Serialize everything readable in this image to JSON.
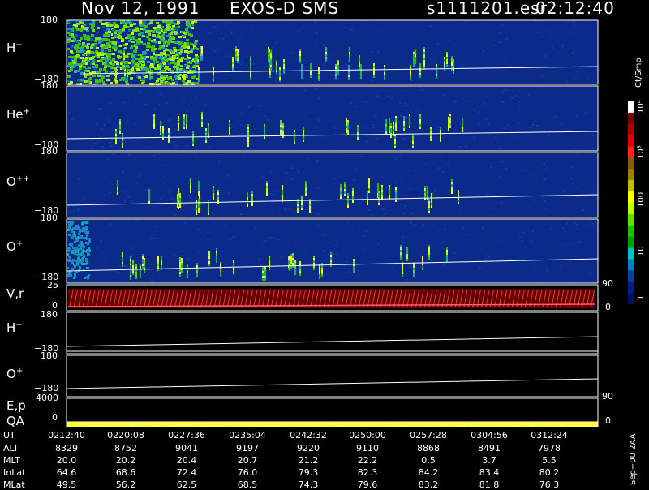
{
  "header": {
    "date": "Nov 12, 1991",
    "instrument": "EXOS-D  SMS",
    "file": "s1111201.esr",
    "time": "02:12:40"
  },
  "panels": [
    {
      "id": "hplus",
      "species": "H",
      "charge": "+",
      "ytop": "180",
      "ybot": "−180"
    },
    {
      "id": "heplus",
      "species": "He",
      "charge": "+",
      "ytop": "180",
      "ybot": "−180"
    },
    {
      "id": "oplusplus",
      "species": "O",
      "charge": "++",
      "ytop": "180",
      "ybot": "−180"
    },
    {
      "id": "oplus",
      "species": "O",
      "charge": "+",
      "ytop": "180",
      "ybot": "−180"
    }
  ],
  "vr_panel": {
    "label": "V,r",
    "ytop": "25",
    "ybot": "0",
    "rtop": "90",
    "rbot": "0"
  },
  "lower_panels": [
    {
      "id": "hplus2",
      "species": "H",
      "charge": "+",
      "ytop": "180",
      "ybot": "−180"
    },
    {
      "id": "oplus2",
      "species": "O",
      "charge": "+",
      "ytop": "180",
      "ybot": "−180"
    }
  ],
  "ep_panel": {
    "label1": "E,p",
    "label2": "QA",
    "ytop": "4000",
    "ybot": "0",
    "rtop": "90",
    "rbot": "0"
  },
  "colorbar": {
    "unit": "Ct/Smp",
    "ticks": [
      "10⁴",
      "10³",
      "100",
      "10",
      "1"
    ],
    "colors": [
      "#ffffff",
      "#7a0000",
      "#b00000",
      "#e00000",
      "#ff2020",
      "#806000",
      "#a08000",
      "#c0c000",
      "#ffff00",
      "#c0ff00",
      "#60e000",
      "#20c000",
      "#00a000",
      "#00c0c0",
      "#0080c0",
      "#0040a0",
      "#002080",
      "#001060"
    ]
  },
  "footer_side": "Sep−00  2AA",
  "table": {
    "rows": [
      {
        "label": "UT",
        "values": [
          "0212:40",
          "0220:08",
          "0227:36",
          "0235:04",
          "0242:32",
          "0250:00",
          "0257:28",
          "0304:56",
          "0312:24"
        ]
      },
      {
        "label": "ALT",
        "values": [
          "8329",
          "8752",
          "9041",
          "9197",
          "9220",
          "9110",
          "8868",
          "8491",
          "7978"
        ]
      },
      {
        "label": "MLT",
        "values": [
          "20.0",
          "20.2",
          "20.4",
          "20.7",
          "21.2",
          "22.2",
          "0.5",
          "3.7",
          "5.5"
        ]
      },
      {
        "label": "InLat",
        "values": [
          "64.6",
          "68.6",
          "72.4",
          "76.0",
          "79.3",
          "82.3",
          "84.2",
          "83.4",
          "80.2"
        ]
      },
      {
        "label": "MLat",
        "values": [
          "49.5",
          "56.2",
          "62.5",
          "68.5",
          "74.3",
          "79.6",
          "83.2",
          "81.8",
          "76.3"
        ]
      }
    ]
  },
  "chart_data": {
    "type": "heatmap",
    "x_ticks": [
      "0212:40",
      "0220:08",
      "0227:36",
      "0235:04",
      "0242:32",
      "0250:00",
      "0257:28",
      "0304:56",
      "0312:24"
    ],
    "panels": [
      "H+",
      "He+",
      "O++",
      "O+"
    ],
    "yrange": [
      -180,
      180
    ],
    "colorbar_scale": "log",
    "colorbar_range": [
      1,
      10000
    ]
  },
  "colors": {
    "background_panel": "#0b2a8a",
    "line": "#ffffff",
    "vr_line": "#ff2020",
    "qa_bar": "#ffff40"
  }
}
